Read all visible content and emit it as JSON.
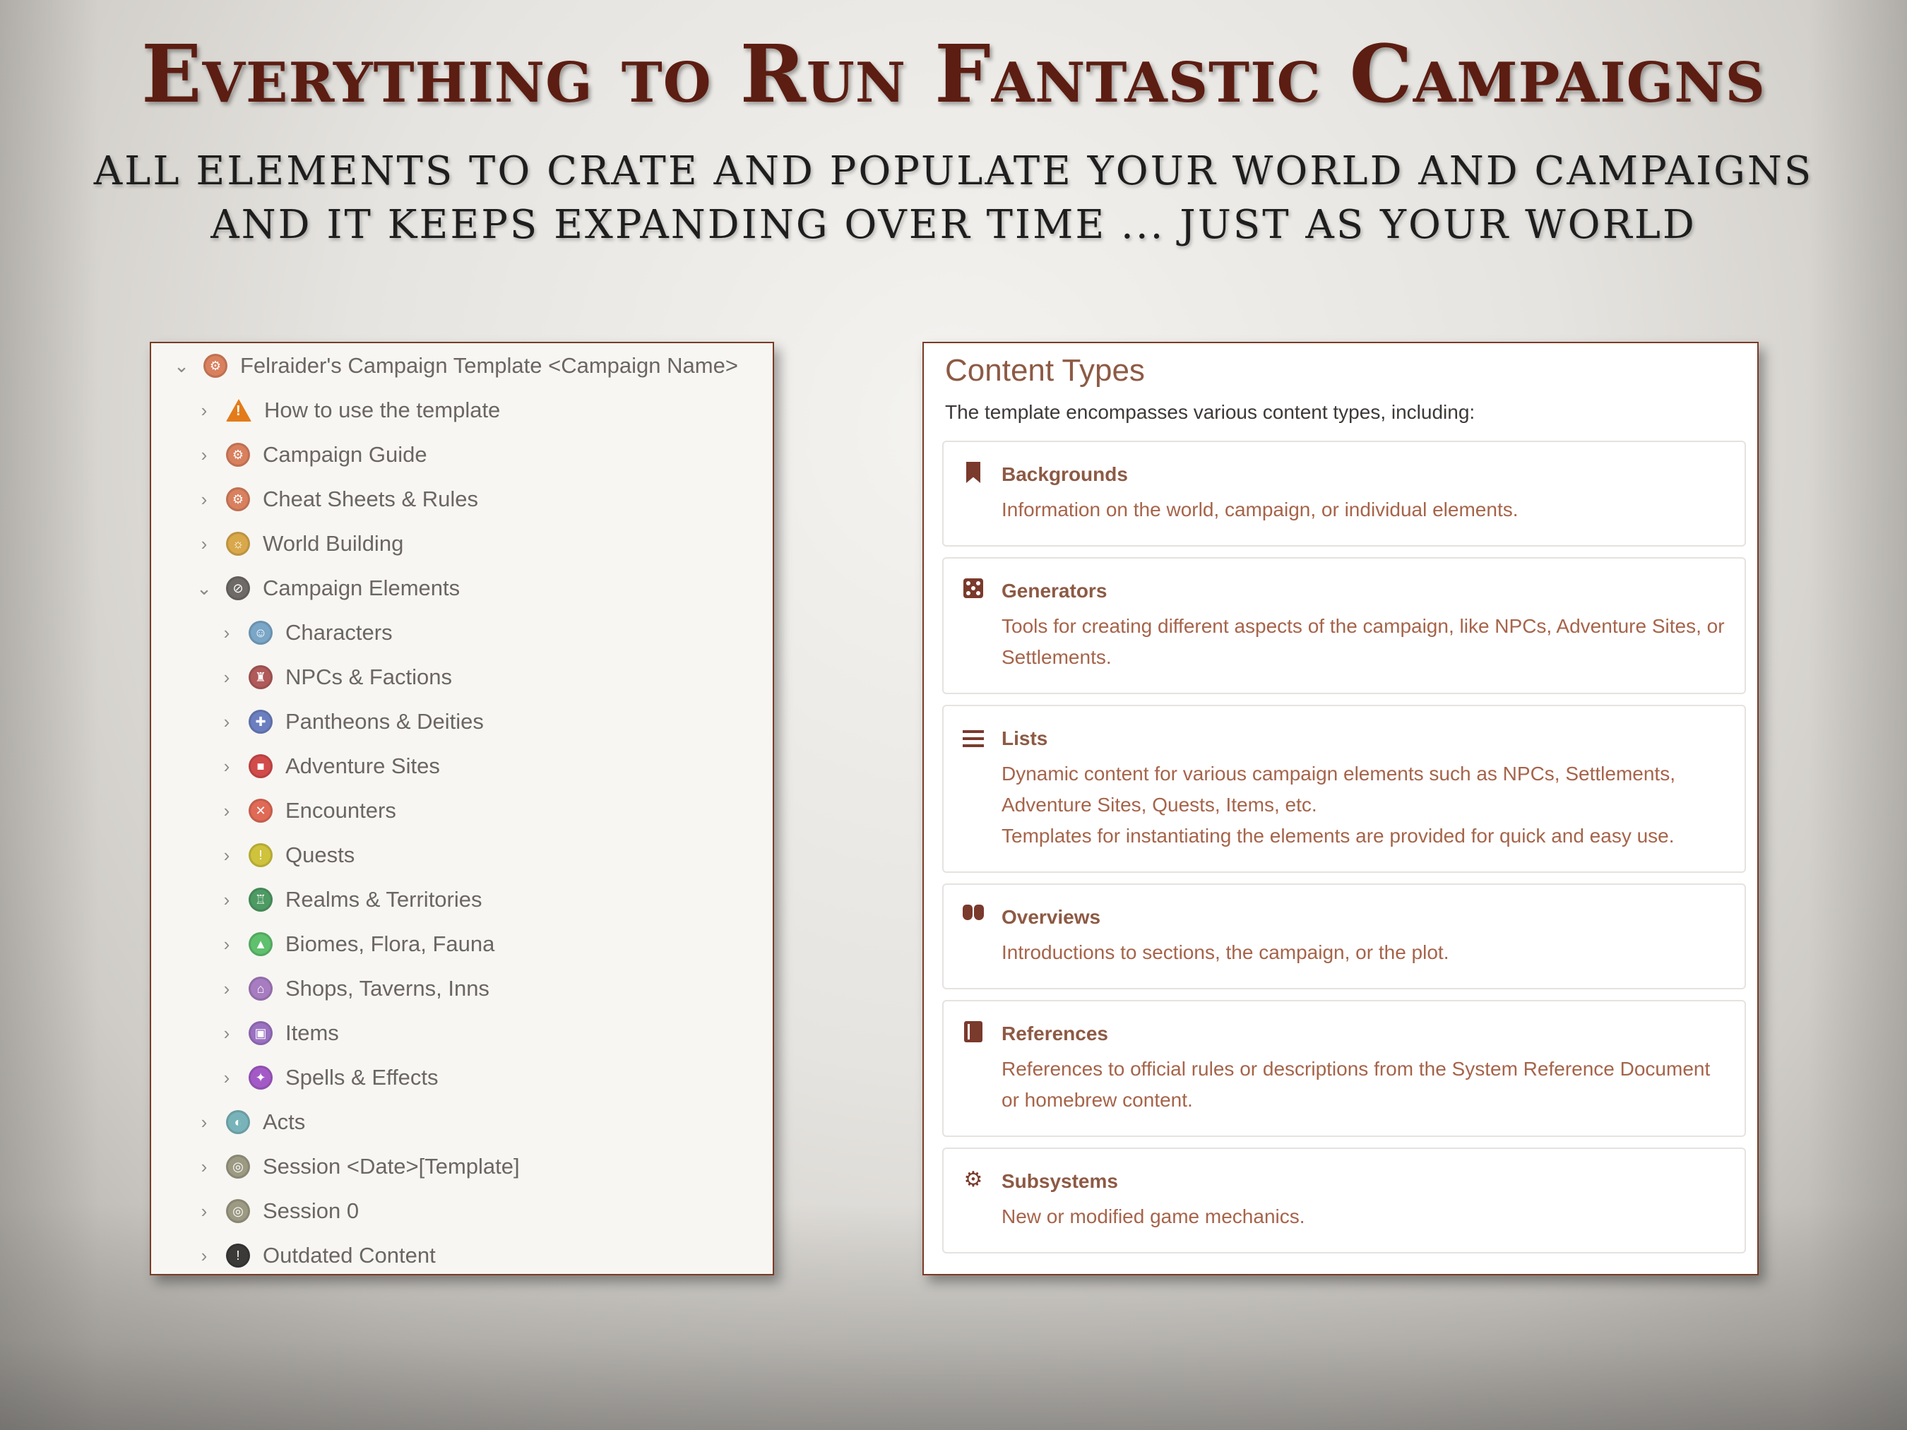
{
  "header": {
    "title": "Everything to Run Fantastic Campaigns",
    "subtitle_line1": "ALL ELEMENTS TO CRATE AND POPULATE YOUR WORLD AND CAMPAIGNS",
    "subtitle_line2": "AND IT KEEPS EXPANDING OVER TIME ... JUST AS YOUR WORLD"
  },
  "tree": {
    "root": "Felraider's Campaign Template <Campaign Name>",
    "items": [
      {
        "label": "How to use the template",
        "icon": "warning-icon",
        "color": "#e37b1a"
      },
      {
        "label": "Campaign Guide",
        "icon": "compass-icon",
        "color": "#d9805e"
      },
      {
        "label": "Cheat Sheets & Rules",
        "icon": "compass-icon",
        "color": "#d9805e"
      },
      {
        "label": "World Building",
        "icon": "globe-icon",
        "color": "#d8a84a"
      },
      {
        "label": "Campaign Elements",
        "icon": "elements-icon",
        "color": "#6e6a67"
      },
      {
        "label": "Characters",
        "icon": "character-icon",
        "color": "#7aa6c7"
      },
      {
        "label": "NPCs & Factions",
        "icon": "faction-icon",
        "color": "#b05a5a"
      },
      {
        "label": "Pantheons & Deities",
        "icon": "deity-icon",
        "color": "#6b7fc0"
      },
      {
        "label": "Adventure Sites",
        "icon": "site-icon",
        "color": "#d24b4b"
      },
      {
        "label": "Encounters",
        "icon": "encounter-icon",
        "color": "#e06a56"
      },
      {
        "label": "Quests",
        "icon": "quest-icon",
        "color": "#cfc23c"
      },
      {
        "label": "Realms & Territories",
        "icon": "realm-icon",
        "color": "#4e9a63"
      },
      {
        "label": "Biomes, Flora, Fauna",
        "icon": "biome-icon",
        "color": "#5fc06e"
      },
      {
        "label": "Shops, Taverns, Inns",
        "icon": "shop-icon",
        "color": "#a77cc0"
      },
      {
        "label": "Items",
        "icon": "item-icon",
        "color": "#9b72c2"
      },
      {
        "label": "Spells & Effects",
        "icon": "spell-icon",
        "color": "#a35ac7"
      },
      {
        "label": "Acts",
        "icon": "acts-icon",
        "color": "#79b3ba"
      },
      {
        "label": "Session <Date>[Template]",
        "icon": "session-icon",
        "color": "#9c9a83"
      },
      {
        "label": "Session 0",
        "icon": "session-icon",
        "color": "#9c9a83"
      },
      {
        "label": "Outdated Content",
        "icon": "alert-icon",
        "color": "#3b3a39"
      }
    ]
  },
  "content_types": {
    "title": "Content Types",
    "intro": "The template encompasses various content types, including:",
    "cards": [
      {
        "title": "Backgrounds",
        "desc": "Information on the world, campaign, or individual elements."
      },
      {
        "title": "Generators",
        "desc": "Tools for creating different aspects of the campaign, like NPCs, Adventure Sites, or Settlements."
      },
      {
        "title": "Lists",
        "desc": "Dynamic content for various campaign elements such as NPCs, Settlements, Adventure Sites, Quests, Items, etc.",
        "desc2": "Templates for instantiating the elements are provided for quick and easy use."
      },
      {
        "title": "Overviews",
        "desc": "Introductions to sections, the campaign, or the plot."
      },
      {
        "title": "References",
        "desc": "References to official rules or descriptions from the System Reference Document or homebrew content."
      },
      {
        "title": "Subsystems",
        "desc": "New or modified game mechanics."
      }
    ]
  }
}
